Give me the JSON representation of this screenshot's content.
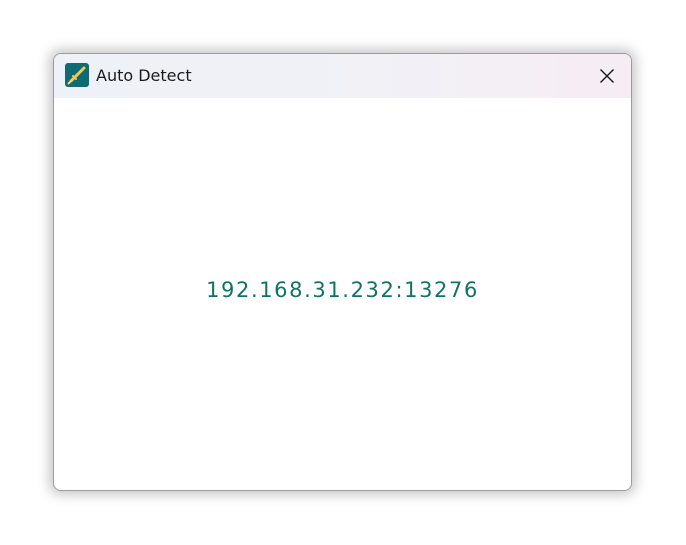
{
  "window": {
    "title": "Auto Detect",
    "app_icon": "pen-tool-icon",
    "close_icon": "close-icon"
  },
  "content": {
    "address": "192.168.31.232:13276"
  },
  "colors": {
    "accent_text": "#117368",
    "icon_background": "#0f6a73",
    "icon_pen": "#f2c94c"
  }
}
